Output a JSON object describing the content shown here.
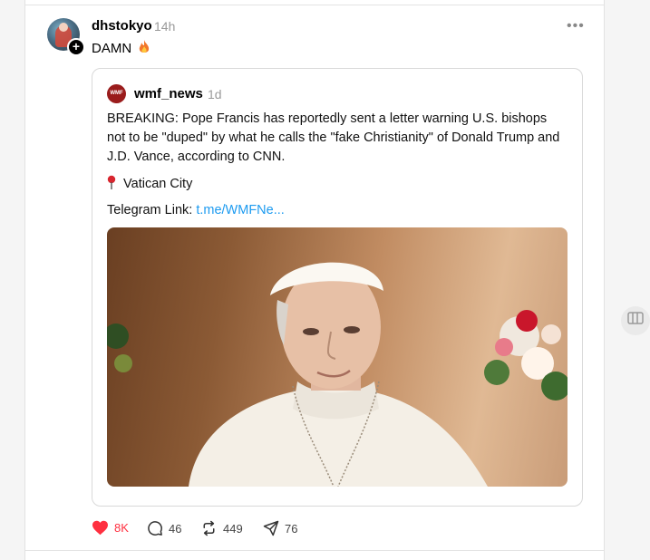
{
  "post": {
    "username": "dhstokyo",
    "time": "14h",
    "text": "DAMN",
    "more_label": "•••",
    "follow_symbol": "+"
  },
  "quote": {
    "avatar_text": "WMF",
    "username": "wmf_news",
    "time": "1d",
    "body": "BREAKING: Pope Francis has reportedly sent a letter warning U.S. bishops not to be \"duped\" by what he calls the \"fake Christianity\" of Donald Trump and J.D. Vance, according to CNN.",
    "location": "Vatican City",
    "link_label": "Telegram Link:",
    "link_text": "t.me/WMFNe..."
  },
  "actions": {
    "likes": "8K",
    "replies": "46",
    "reposts": "449",
    "shares": "76"
  },
  "colors": {
    "like": "#ff3040",
    "link": "#1d9bf0"
  }
}
